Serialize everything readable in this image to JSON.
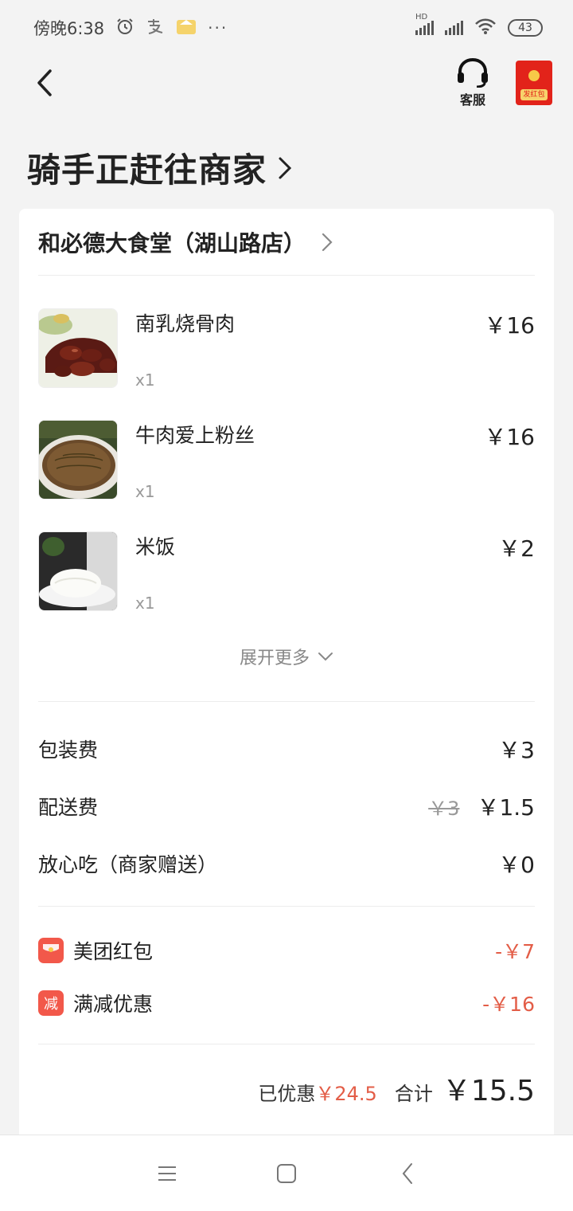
{
  "status_bar": {
    "time": "傍晚6:38",
    "more": "···",
    "battery": "43",
    "network_label": "HD"
  },
  "header": {
    "service_label": "客服",
    "redpacket_label": "发红包"
  },
  "order_status": {
    "title": "骑手正赶往商家"
  },
  "shop": {
    "name": "和必德大食堂（湖山路店）"
  },
  "dishes": [
    {
      "name": "南乳烧骨肉",
      "qty": "x1",
      "price": "￥16"
    },
    {
      "name": "牛肉爱上粉丝",
      "qty": "x1",
      "price": "￥16"
    },
    {
      "name": "米饭",
      "qty": "x1",
      "price": "￥2"
    }
  ],
  "expand_more": "展开更多",
  "fees": {
    "packing": {
      "label": "包装费",
      "value": "￥3"
    },
    "delivery": {
      "label": "配送费",
      "original": "￥3",
      "value": "￥1.5"
    },
    "safe_eat": {
      "label": "放心吃（商家赠送）",
      "value": "￥0"
    }
  },
  "discounts": {
    "redpacket": {
      "label": "美团红包",
      "value": "-￥7"
    },
    "full_reduction": {
      "label": "满减优惠",
      "icon_text": "减",
      "value": "-￥16"
    }
  },
  "summary": {
    "saved_label": "已优惠",
    "saved_value": "￥24.5",
    "total_label": "合计",
    "total_value": "￥15.5"
  },
  "colors": {
    "accent_red": "#e35d47",
    "redpacket_red": "#e2231a",
    "background": "#f3f3f3"
  }
}
